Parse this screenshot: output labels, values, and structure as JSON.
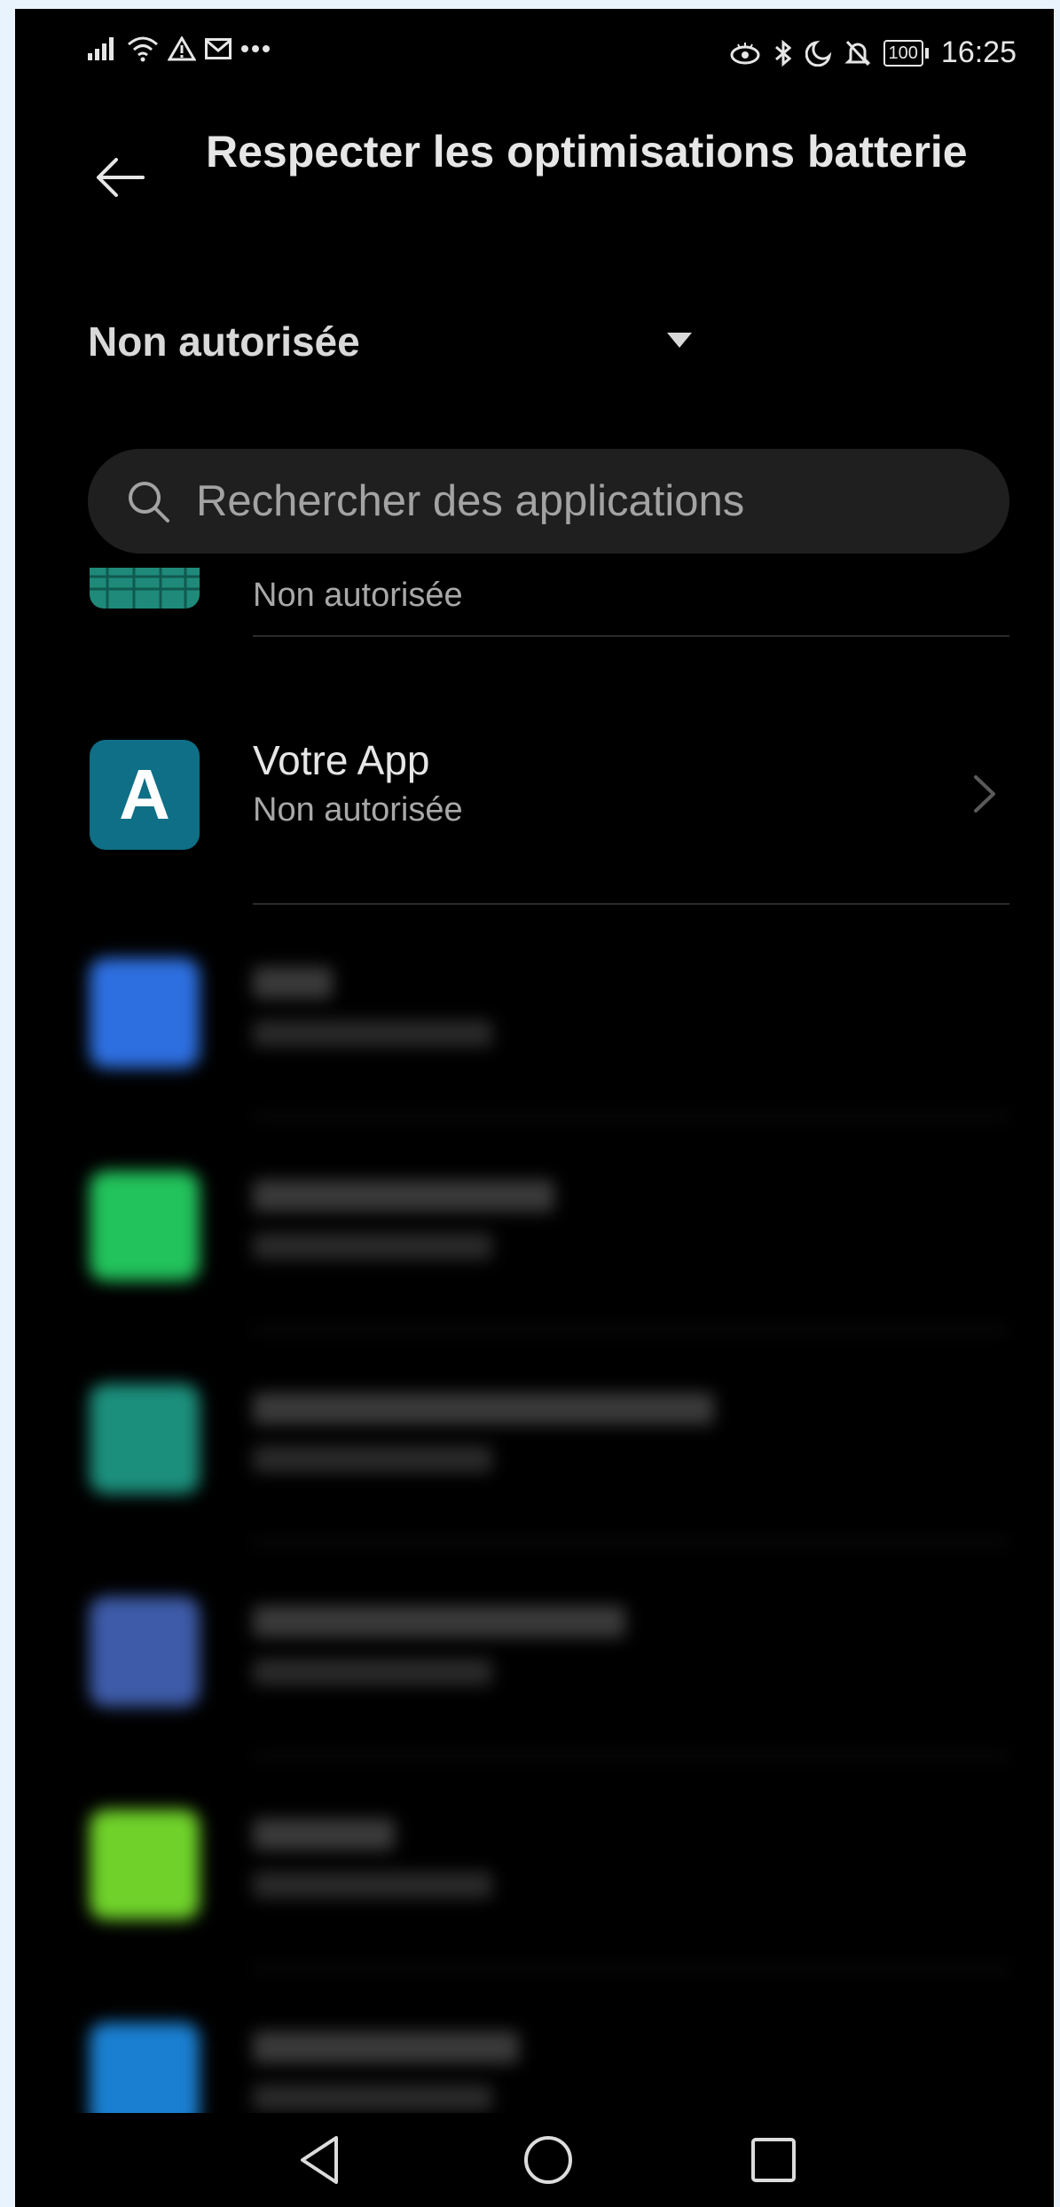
{
  "status_bar": {
    "battery": "100",
    "time": "16:25"
  },
  "header": {
    "title": "Respecter les optimisations batterie"
  },
  "filter": {
    "selected": "Non autorisée"
  },
  "search": {
    "placeholder": "Rechercher des applications"
  },
  "apps": [
    {
      "name": "",
      "status": "Non autorisée",
      "icon": "app-icon-partial",
      "color": "#1f8a7a"
    },
    {
      "name": "Votre App",
      "status": "Non autorisée",
      "icon": "votre-app-icon",
      "letter": "A",
      "color": "#0e6f86"
    },
    {
      "name": "",
      "status": "",
      "icon": "blurred-app-icon",
      "color": "#2d6fe0"
    },
    {
      "name": "",
      "status": "",
      "icon": "blurred-app-icon",
      "color": "#22c25c"
    },
    {
      "name": "",
      "status": "",
      "icon": "blurred-app-icon",
      "color": "#1c8f7c"
    },
    {
      "name": "",
      "status": "",
      "icon": "blurred-app-icon",
      "color": "#3d5ba8"
    },
    {
      "name": "",
      "status": "",
      "icon": "blurred-app-icon",
      "color": "#6fd12a"
    },
    {
      "name": "",
      "status": "",
      "icon": "blurred-app-icon",
      "color": "#1a7fd0"
    }
  ]
}
